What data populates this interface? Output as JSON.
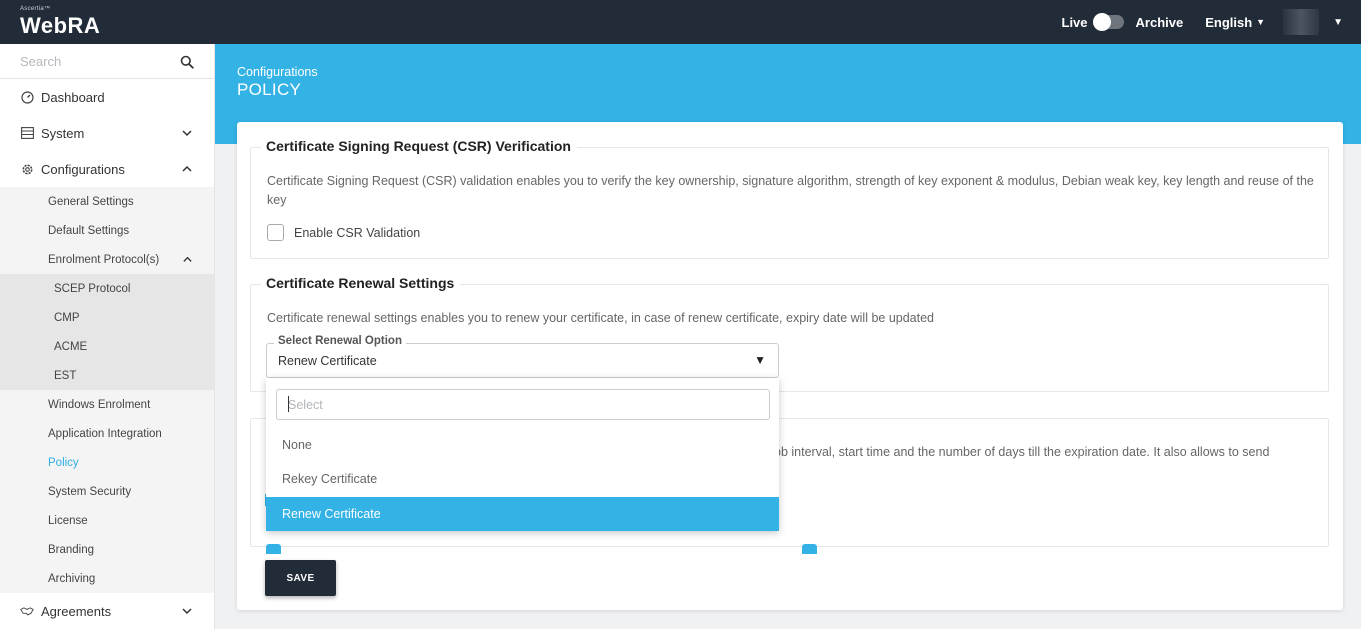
{
  "topbar": {
    "logo_small": "Ascertia™",
    "logo_main": "WebRA",
    "live_label": "Live",
    "archive_label": "Archive",
    "language": "English"
  },
  "sidebar": {
    "search_placeholder": "Search",
    "items": {
      "dashboard": "Dashboard",
      "system": "System",
      "configurations": "Configurations",
      "general_settings": "General Settings",
      "default_settings": "Default Settings",
      "enrolment_protocols": "Enrolment Protocol(s)",
      "scep": "SCEP Protocol",
      "cmp": "CMP",
      "acme": "ACME",
      "est": "EST",
      "windows_enrolment": "Windows Enrolment",
      "application_integration": "Application Integration",
      "policy": "Policy",
      "system_security": "System Security",
      "license": "License",
      "branding": "Branding",
      "archiving": "Archiving",
      "agreements": "Agreements"
    }
  },
  "header": {
    "breadcrumb": "Configurations",
    "title": "POLICY"
  },
  "csr": {
    "legend": "Certificate Signing Request (CSR) Verification",
    "description": "Certificate Signing Request (CSR) validation enables you to verify the key ownership, signature algorithm, strength of key exponent & modulus, Debian weak key, key length and reuse of the key",
    "checkbox_label": "Enable CSR Validation"
  },
  "renewal": {
    "legend": "Certificate Renewal Settings",
    "description": "Certificate renewal settings enables you to renew your certificate, in case of renew certificate, expiry date will be updated",
    "select_label": "Select Renewal Option",
    "select_value": "Renew Certificate",
    "dropdown_search_placeholder": "Select",
    "options": [
      "None",
      "Rekey Certificate",
      "Renew Certificate"
    ]
  },
  "expiry": {
    "description_partial": "ob interval, start time and the number of days till the expiration date. It also allows to send"
  },
  "actions": {
    "save_label": "SAVE"
  },
  "colors": {
    "topbar_bg": "#222b38",
    "accent": "#33b2e5"
  }
}
